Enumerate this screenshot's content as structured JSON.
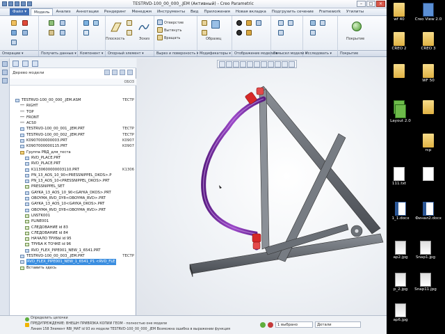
{
  "window": {
    "title": "TESTRVD-100_00_000_.JEM (Активный) - Creo Parametric",
    "buttons": [
      "–",
      "□",
      "×"
    ]
  },
  "menu": {
    "file": "Файл ▾",
    "tabs": [
      "Модель",
      "Анализ",
      "Аннотации",
      "Рендеринг",
      "Менеджм",
      "Инструменты",
      "Вид",
      "Приложения",
      "Новая вкладка",
      "Подгрузить сечение",
      "Framework",
      "Утилиты"
    ],
    "active": "Модель"
  },
  "ribbon": {
    "labels": [
      "Плоскость",
      "Эскиз",
      "Отверстие",
      "Вытянуть",
      "Вращать",
      "Образец",
      "Покрытие"
    ]
  },
  "groups": [
    "Операции ▾",
    "Получить данные ▾",
    "Компонент ▾",
    "Опорный элемент ▾",
    "Вырез и поверхность ▾",
    "Модификаторы ▾",
    "Отображение модели ▾",
    "Замысел модели ▾",
    "Исследовать ▾",
    "Покрытие"
  ],
  "tree": {
    "title": "Дерево модели",
    "column": "ОБОЗ",
    "rows": [
      {
        "text": "TESTRVD-100_00_000_.JEM.ASM",
        "value": "ТЕСТР",
        "icon": "asm",
        "indent": 0
      },
      {
        "text": "RIGHT",
        "value": "",
        "icon": "datum",
        "indent": 1
      },
      {
        "text": "TOP",
        "value": "",
        "icon": "datum",
        "indent": 1
      },
      {
        "text": "FRONT",
        "value": "",
        "icon": "datum",
        "indent": 1
      },
      {
        "text": "ACS0",
        "value": "",
        "icon": "datum",
        "indent": 1
      },
      {
        "text": "TESTRVD-100_00_001_.JEM.PRT",
        "value": "ТЕСТР",
        "icon": "part",
        "indent": 1
      },
      {
        "text": "TESTRVD-100_00_002_.JEM.PRT",
        "value": "ТЕСТР",
        "icon": "part",
        "indent": 1
      },
      {
        "text": "K0907000000003.PRT",
        "value": "K0907",
        "icon": "part",
        "indent": 1
      },
      {
        "text": "K0907000000115.PRT",
        "value": "K0907",
        "icon": "part",
        "indent": 1
      },
      {
        "text": "Группа РВД_для_теста",
        "value": "",
        "icon": "group",
        "indent": 1
      },
      {
        "text": "RVD_PLACE.PRT",
        "value": "",
        "icon": "part",
        "indent": 2
      },
      {
        "text": "RVD_PLACE.PRT",
        "value": "",
        "icon": "part",
        "indent": 2
      },
      {
        "text": "K1130600000003110.PRT",
        "value": "K1306",
        "icon": "part",
        "indent": 2
      },
      {
        "text": "PN_13_AOS_10_90<PRESSNIPPEL_DKOS>.P",
        "value": "",
        "icon": "part",
        "indent": 2
      },
      {
        "text": "PN_13_AOS_10<PRESSNIPPEL_DKOS>.PRT",
        "value": "",
        "icon": "part",
        "indent": 2
      },
      {
        "text": "PRESSNIPPEL_SET",
        "value": "",
        "icon": "feature",
        "indent": 2
      },
      {
        "text": "GAYKA_13_AOS_10_90<GAYKA_DKOS>.PRT",
        "value": "",
        "icon": "part",
        "indent": 2
      },
      {
        "text": "OBOYMA_RVD_DY8<OBOYMA_RVD>.PRT",
        "value": "",
        "icon": "part",
        "indent": 2
      },
      {
        "text": "GAYKA_13_AOS_10<GAYKA_DKOS>.PRT",
        "value": "",
        "icon": "part",
        "indent": 2
      },
      {
        "text": "OBOYMA_RVD_DY8<OBOYMA_RVD>.PRT",
        "value": "",
        "icon": "part",
        "indent": 2
      },
      {
        "text": "LNSTK001",
        "value": "",
        "icon": "feature",
        "indent": 2
      },
      {
        "text": "PLINE001",
        "value": "",
        "icon": "feature",
        "indent": 2
      },
      {
        "text": "СЛЕДОВАНИЕ id 83",
        "value": "",
        "icon": "feature",
        "indent": 2
      },
      {
        "text": "СЛЕДОВАНИЕ id 84",
        "value": "",
        "icon": "feature",
        "indent": 2
      },
      {
        "text": "НАЧАЛО ТРУБЫ id 95",
        "value": "",
        "icon": "feature",
        "indent": 2
      },
      {
        "text": "ТРУБА К ТОЧКЕ id 96",
        "value": "",
        "icon": "feature",
        "indent": 2
      },
      {
        "text": "RVD_FLEX_PIPE001_NEW_1_6541.PRT",
        "value": "",
        "icon": "part",
        "indent": 2
      },
      {
        "text": "TESTRVD-100_00_003_.JEM.PRT",
        "value": "ТЕСТР",
        "icon": "part",
        "indent": 1
      },
      {
        "text": "RVD_FLEX_PIPE001_NEW_1_6541_P1 <RVD_FLE",
        "value": "",
        "icon": "part",
        "indent": 1,
        "selected": true
      },
      {
        "text": "Вставить здесь",
        "value": "",
        "icon": "insert",
        "indent": 1
      }
    ]
  },
  "status": {
    "messages": [
      "Определить цепочки",
      "ПРЕДУПРЕЖДЕНИЕ: ВНЕШН ПРИВЯЗКА КОПИИ ГЕОМ - полностью оне модели",
      "Линия 158 Элемент RBI_MAT id 93 из модели TESTRVD-100_00_000_.JEM Возможна ошибка в выражении функция"
    ],
    "count": "1 выбрано",
    "detail": "Детали"
  },
  "desktop": {
    "icons": [
      {
        "label": "wf 40",
        "kind": "folder"
      },
      {
        "label": "Creo View 2.0",
        "kind": "monitor"
      },
      {
        "label": "CREO 2",
        "kind": "folder"
      },
      {
        "label": "CREO 3",
        "kind": "folder"
      },
      {
        "label": "",
        "kind": "folder"
      },
      {
        "label": "WF 50",
        "kind": "folder"
      },
      {
        "label": "",
        "kind": "green"
      },
      {
        "label": "Layout 2.0",
        "kind": "green"
      },
      {
        "label": "",
        "kind": "folder"
      },
      {
        "label": "rcp",
        "kind": "folder"
      },
      {
        "label": "111.txt",
        "kind": "doc"
      },
      {
        "label": "",
        "kind": "doc"
      },
      {
        "label": "1_1.docx",
        "kind": "word"
      },
      {
        "label": "Финал2.docx",
        "kind": "word"
      },
      {
        "label": "ap2.jpg",
        "kind": "jpg"
      },
      {
        "label": "Snap1.jpg",
        "kind": "jpg"
      },
      {
        "label": "p_2.jpg",
        "kind": "jpg"
      },
      {
        "label": "Snap11.jpg",
        "kind": "jpg"
      },
      {
        "label": "ap6.jpg",
        "kind": "jpg"
      }
    ]
  },
  "colors": {
    "hose": "#7a2aa8",
    "fitting": "#d62828",
    "frame": "#5a5e64",
    "selection": "#3b8ee0"
  }
}
